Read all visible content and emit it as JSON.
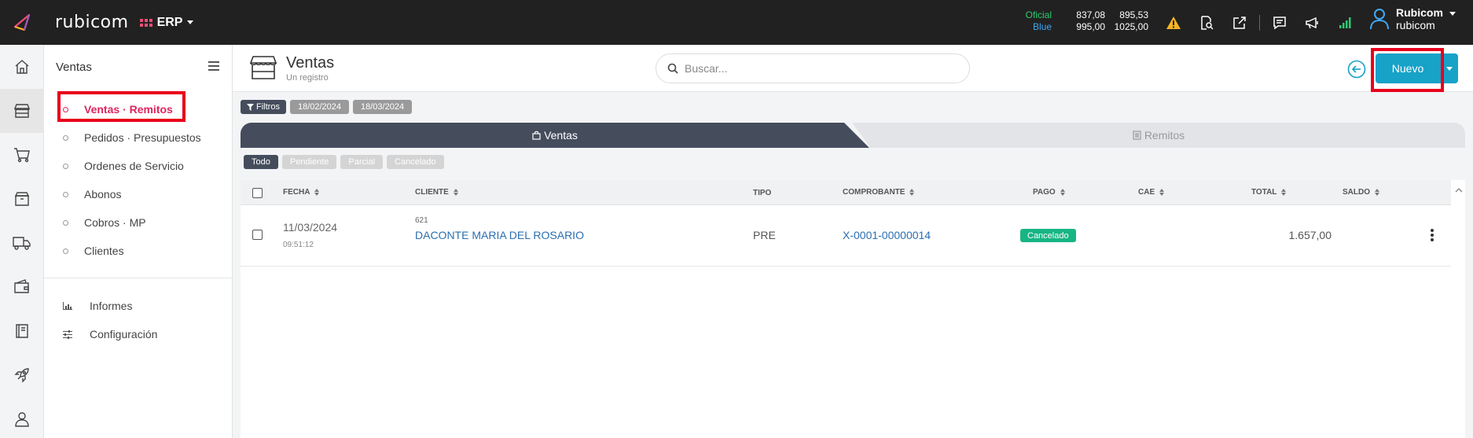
{
  "topbar": {
    "brand": "rubicom",
    "module": "ERP",
    "rates": {
      "oficial_label": "Oficial",
      "oficial_buy": "837,08",
      "oficial_sell": "895,53",
      "blue_label": "Blue",
      "blue_buy": "995,00",
      "blue_sell": "1025,00"
    },
    "icons": [
      "warning-icon",
      "search-document-icon",
      "external-link-icon",
      "chat-icon",
      "megaphone-icon",
      "signal-icon"
    ],
    "user": {
      "name": "Rubicom",
      "company": "rubicom"
    },
    "colors": {
      "oficial": "#2ecc71",
      "blue": "#3fa9f5",
      "warning": "#f5b324",
      "signal": "#2ecc71"
    }
  },
  "rail": [
    "home-icon",
    "store-icon",
    "cart-icon",
    "box-icon",
    "truck-icon",
    "wallet-icon",
    "book-icon",
    "rocket-icon",
    "user-icon"
  ],
  "sidebar": {
    "title": "Ventas",
    "items": [
      {
        "label": "Ventas · Remitos",
        "active": true
      },
      {
        "label": "Pedidos · Presupuestos"
      },
      {
        "label": "Ordenes de Servicio"
      },
      {
        "label": "Abonos"
      },
      {
        "label": "Cobros · MP"
      },
      {
        "label": "Clientes"
      }
    ],
    "secondary": [
      {
        "label": "Informes",
        "icon": "chart-icon"
      },
      {
        "label": "Configuración",
        "icon": "sliders-icon"
      }
    ]
  },
  "header": {
    "title": "Ventas",
    "subtitle": "Un registro",
    "search_placeholder": "Buscar...",
    "new_button": "Nuevo"
  },
  "filters": {
    "label": "Filtros",
    "date_from": "18/02/2024",
    "date_to": "18/03/2024"
  },
  "tabs": [
    {
      "label": "Ventas",
      "active": true
    },
    {
      "label": "Remitos"
    }
  ],
  "status_filters": [
    "Todo",
    "Pendiente",
    "Parcial",
    "Cancelado"
  ],
  "table": {
    "columns": [
      "Fecha",
      "Cliente",
      "Tipo",
      "Comprobante",
      "Pago",
      "CAE",
      "Total",
      "Saldo"
    ],
    "rows": [
      {
        "fecha": "11/03/2024",
        "hora": "09:51:12",
        "cliente_id": "621",
        "cliente": "DACONTE MARIA DEL ROSARIO",
        "tipo": "PRE",
        "comprobante": "X-0001-00000014",
        "pago": "Cancelado",
        "cae": "",
        "total": "1.657,00",
        "saldo": ""
      }
    ]
  },
  "accent_colors": {
    "primary": "#17a2c8",
    "active_nav": "#e0245e",
    "paid_badge": "#17b583",
    "tab_dark": "#454d5d"
  }
}
